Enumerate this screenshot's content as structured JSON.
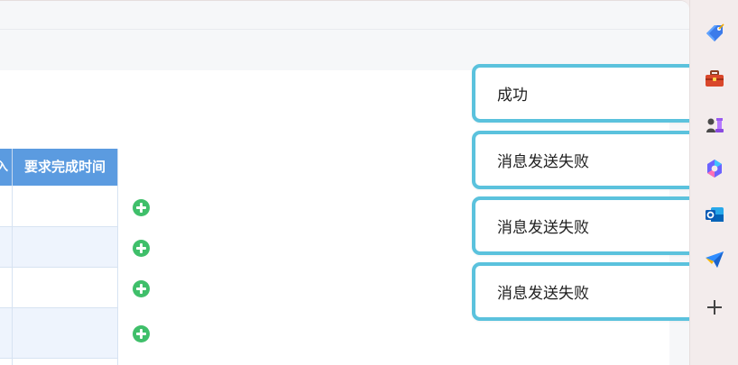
{
  "table": {
    "header_cut": "入",
    "header_main": "要求完成时间",
    "rows": [
      "",
      "",
      "",
      "",
      ""
    ]
  },
  "add_buttons": 4,
  "toasts": [
    {
      "text": "成功"
    },
    {
      "text": "消息发送失败"
    },
    {
      "text": "消息发送失败"
    },
    {
      "text": "消息发送失败"
    }
  ],
  "sidebar": {
    "icons": [
      "tag-icon",
      "toolbox-icon",
      "chess-icon",
      "copilot-icon",
      "outlook-icon",
      "send-icon",
      "add-icon"
    ]
  },
  "colors": {
    "table_header": "#5b9be0",
    "toast_border": "#5bc2dd",
    "add_green": "#3fbf6a"
  }
}
